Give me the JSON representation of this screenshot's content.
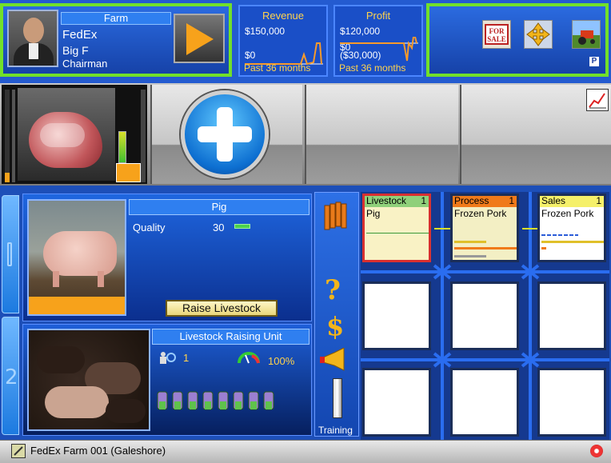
{
  "profile": {
    "company_type": "Farm",
    "company": "FedEx",
    "name": "Big F",
    "title": "Chairman"
  },
  "revenue": {
    "title": "Revenue",
    "top": "$150,000",
    "bottom": "$0",
    "period": "Past 36 months"
  },
  "profit": {
    "title": "Profit",
    "top": "$120,000",
    "zero": "$0",
    "bottom": "($30,000)",
    "period": "Past 36 months"
  },
  "toolbox": {
    "for_sale_icon": "for-sale-icon",
    "move_icon": "move-arrows-icon",
    "farm_icon": "farm-tractor-icon",
    "p_label": "P"
  },
  "product": {
    "name": "Pig",
    "quality_label": "Quality",
    "quality_value": "30",
    "raise_button": "Raise Livestock"
  },
  "raising_unit": {
    "title": "Livestock Raising Unit",
    "workers": "1",
    "efficiency": "100%"
  },
  "side": {
    "training_label": "Training"
  },
  "units": {
    "livestock": {
      "title": "Livestock",
      "count": "1",
      "product": "Pig"
    },
    "process": {
      "title": "Process",
      "count": "1",
      "product": "Frozen Pork"
    },
    "sales": {
      "title": "Sales",
      "count": "1",
      "product": "Frozen Pork"
    }
  },
  "status": {
    "text": "FedEx Farm 001 (Galeshore)"
  },
  "colors": {
    "accent_orange": "#f7a21b",
    "green_frame": "#72e02a",
    "blue": "#1d4fb8"
  }
}
